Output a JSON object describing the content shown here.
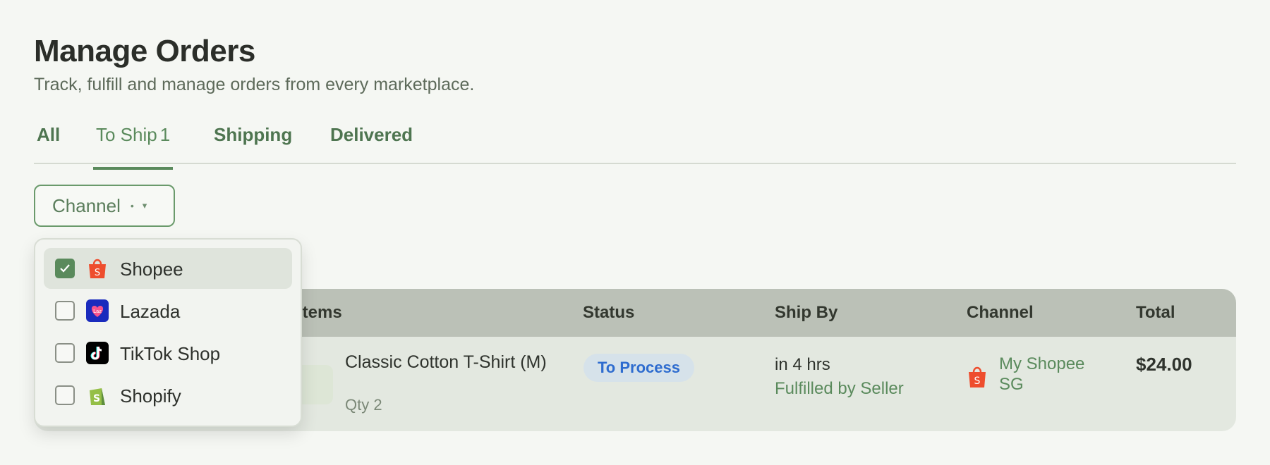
{
  "header": {
    "title": "Manage Orders",
    "subtitle": "Track, fulfill and manage orders from every marketplace."
  },
  "tabs": [
    {
      "label": "All"
    },
    {
      "label": "To Ship",
      "count": "1"
    },
    {
      "label": "Shipping"
    },
    {
      "label": "Delivered"
    }
  ],
  "filter": {
    "channel_label": "Channel",
    "dot": "•",
    "caret": "▾"
  },
  "channel_options": [
    {
      "label": "Shopee",
      "checked": true,
      "icon": "shopee-icon",
      "color": "#ee4d2d"
    },
    {
      "label": "Lazada",
      "checked": false,
      "icon": "lazada-icon",
      "color": "#1a2bbd"
    },
    {
      "label": "TikTok Shop",
      "checked": false,
      "icon": "tiktok-icon",
      "color": "#000000"
    },
    {
      "label": "Shopify",
      "checked": false,
      "icon": "shopify-icon",
      "color": "#95bf47"
    }
  ],
  "table": {
    "columns": {
      "items": "Items",
      "status": "Status",
      "ship_by": "Ship By",
      "channel": "Channel",
      "total": "Total"
    },
    "rows": [
      {
        "item_name": "Classic Cotton T-Shirt (M)",
        "qty": "Qty 2",
        "status": "To Process",
        "ship_by": "in 4 hrs",
        "fulfillment": "Fulfilled by Seller",
        "channel_icon": "shopee-icon",
        "channel_name": "My Shopee SG",
        "total": "$24.00"
      }
    ]
  },
  "colors": {
    "accent": "#5a8a5c",
    "status_blue": "#2e6ccf",
    "shopee": "#ee4d2d"
  }
}
